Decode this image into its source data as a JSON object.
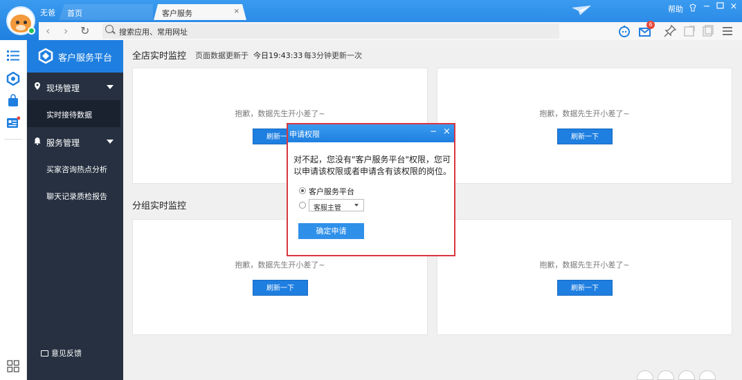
{
  "colors": {
    "accent": "#1f7fe0",
    "sidebar": "#263040",
    "dialog_border": "#d9363e",
    "badge": "#e8473a"
  },
  "topbar": {
    "user_name": "无爸",
    "tabs": [
      {
        "label": "首页"
      },
      {
        "label": "客户服务",
        "close": "×"
      }
    ],
    "help_label": "帮助",
    "mail_badge": "6"
  },
  "nav": {
    "back_glyph": "‹",
    "forward_glyph": "›",
    "refresh_glyph": "↻",
    "search_placeholder": "搜索应用、常用网址"
  },
  "sidebar": {
    "brand_title": "客户服务平台",
    "groups": [
      {
        "label": "现场管理",
        "items": [
          {
            "label": "实时接待数据",
            "active": true
          }
        ]
      },
      {
        "label": "服务管理",
        "items": [
          {
            "label": "买家咨询热点分析"
          },
          {
            "label": "聊天记录质检报告"
          }
        ]
      }
    ],
    "feedback_label": "意见反馈"
  },
  "main": {
    "store_title": "全店实时监控",
    "update_prefix": "页面数据更新于",
    "update_time": "今日19:43:33",
    "update_interval": "每3分钟更新一次",
    "group_title": "分组实时监控",
    "card_message": "抱歉，数据先生开小差了~",
    "refresh_label": "刷新一下"
  },
  "dialog": {
    "title": "申请权限",
    "min_glyph": "−",
    "close_glyph": "×",
    "message": "对不起，您没有\"客户服务平台\"权限，您可以申请该权限或者申请含有该权限的岗位。",
    "option1_label": "客户服务平台",
    "option2_value": "客服主管",
    "confirm_label": "确定申请"
  }
}
